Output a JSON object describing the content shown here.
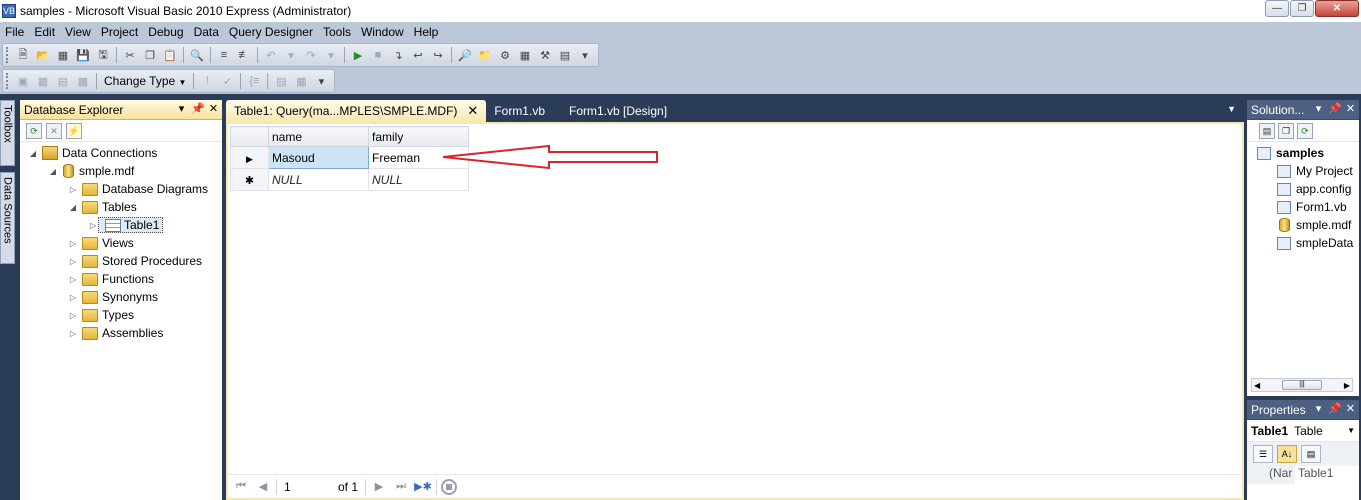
{
  "window": {
    "title": "samples - Microsoft Visual Basic 2010 Express (Administrator)",
    "minimize_icon": "minimize-icon",
    "maximize_icon": "restore-icon",
    "close_icon": "close-icon"
  },
  "menu": [
    "File",
    "Edit",
    "View",
    "Project",
    "Debug",
    "Data",
    "Query Designer",
    "Tools",
    "Window",
    "Help"
  ],
  "toolbar2": {
    "change_type_label": "Change Type"
  },
  "side_tabs": {
    "toolbox": "Toolbox",
    "data_sources": "Data Sources"
  },
  "db_explorer": {
    "title": "Database Explorer",
    "tree": {
      "data_connections": "Data Connections",
      "database": "smple.mdf",
      "database_diagrams": "Database Diagrams",
      "tables": "Tables",
      "table1": "Table1",
      "views": "Views",
      "stored_procedures": "Stored Procedures",
      "functions": "Functions",
      "synonyms": "Synonyms",
      "types": "Types",
      "assemblies": "Assemblies"
    }
  },
  "doc_tabs": {
    "active": "Table1: Query(ma...MPLES\\SMPLE.MDF)",
    "tab2": "Form1.vb",
    "tab3": "Form1.vb [Design]"
  },
  "grid": {
    "columns": [
      "name",
      "family"
    ],
    "rows": [
      {
        "marker": "▶",
        "name": "Masoud",
        "family": "Freeman"
      },
      {
        "marker": "✱",
        "name": "NULL",
        "family": "NULL"
      }
    ]
  },
  "annotation": {
    "color": "#d8242b"
  },
  "record_nav": {
    "current": "1",
    "of_label": "of 1"
  },
  "solution_explorer": {
    "title": "Solution...",
    "project": "samples",
    "items": [
      "My Project",
      "app.config",
      "Form1.vb",
      "smple.mdf",
      "smpleData"
    ]
  },
  "properties": {
    "title": "Properties",
    "object_name": "Table1",
    "object_type": "Table",
    "row": {
      "name": "(Nar",
      "value": "Table1"
    }
  },
  "colors": {
    "ide_background": "#2b3c59",
    "active_tab": "#f7e8b0",
    "chrome": "#bcc7d8"
  }
}
